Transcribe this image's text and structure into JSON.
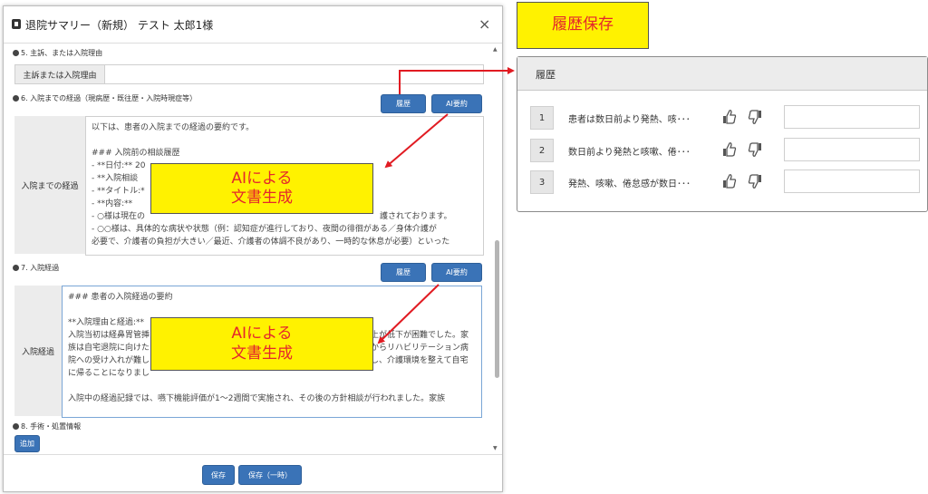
{
  "modal": {
    "title": "退院サマリー（新規） テスト 太郎1様",
    "close": "×",
    "section5": {
      "title": "5. 主訴、または入院理由",
      "label": "主訴または入院理由",
      "value": ""
    },
    "section6": {
      "title": "6. 入院までの経過（現病歴・既往歴・入院時現症等）",
      "history_button": "履歴",
      "ai_button": "AI要約",
      "label": "入院までの経過",
      "lines": [
        "以下は、患者の入院までの経過の要約です。",
        "",
        "### 入院前の相談履歴",
        "- **日付:** 20",
        "- **入院相談",
        "- **タイトル:*",
        "- **内容:**",
        "  - ○様は現在の",
        "  - ○○様は、具体的な病状や状態（例：認知症が進行しており、夜間の徘徊がある／身体介護が",
        "必要で、介護者の負担が大きい／最近、介護者の体調不良があり、一時的な休息が必要）といった"
      ],
      "line8_tail": "護されております。"
    },
    "section7": {
      "title": "7. 入院経過",
      "history_button": "履歴",
      "ai_button": "AI要約",
      "label": "入院経過",
      "lines": [
        "### 患者の入院経過の要約",
        "",
        "**入院理由と経過:**",
        "入院当初は経鼻胃管挿",
        "族は自宅退院に向けた",
        "院への受け入れが難し",
        "に帰ることになりまし",
        "",
        "入院中の経過記録では、嚥下機能評価が1～2週間で実施され、その後の方針相談が行われました。家族"
      ],
      "right_fragments": [
        "上が低下が困難でした。家",
        "からリハビリテーション病",
        "し、介護環境を整えて自宅"
      ]
    },
    "section8": {
      "title": "8. 手術・処置情報",
      "add_button": "追加"
    },
    "footer": {
      "save": "保存",
      "save_temp": "保存（一時）"
    }
  },
  "annotations": {
    "history_save": "履歴保存",
    "ai_generation_1": "AIによる\n文書生成",
    "ai_generation_2": "AIによる\n文書生成"
  },
  "history_panel": {
    "title": "履歴",
    "rows": [
      {
        "num": "1",
        "text": "患者は数日前より発熱、咳･･･",
        "input": ""
      },
      {
        "num": "2",
        "text": "数日前より発熱と咳嗽、倦･･･",
        "input": ""
      },
      {
        "num": "3",
        "text": "発熱、咳嗽、倦怠感が数日･･･",
        "input": ""
      }
    ]
  },
  "colors": {
    "button_blue": "#3a73b7",
    "highlight_yellow": "#fff200",
    "annotation_red": "#e4262c",
    "arrow_red": "#e11b22"
  }
}
